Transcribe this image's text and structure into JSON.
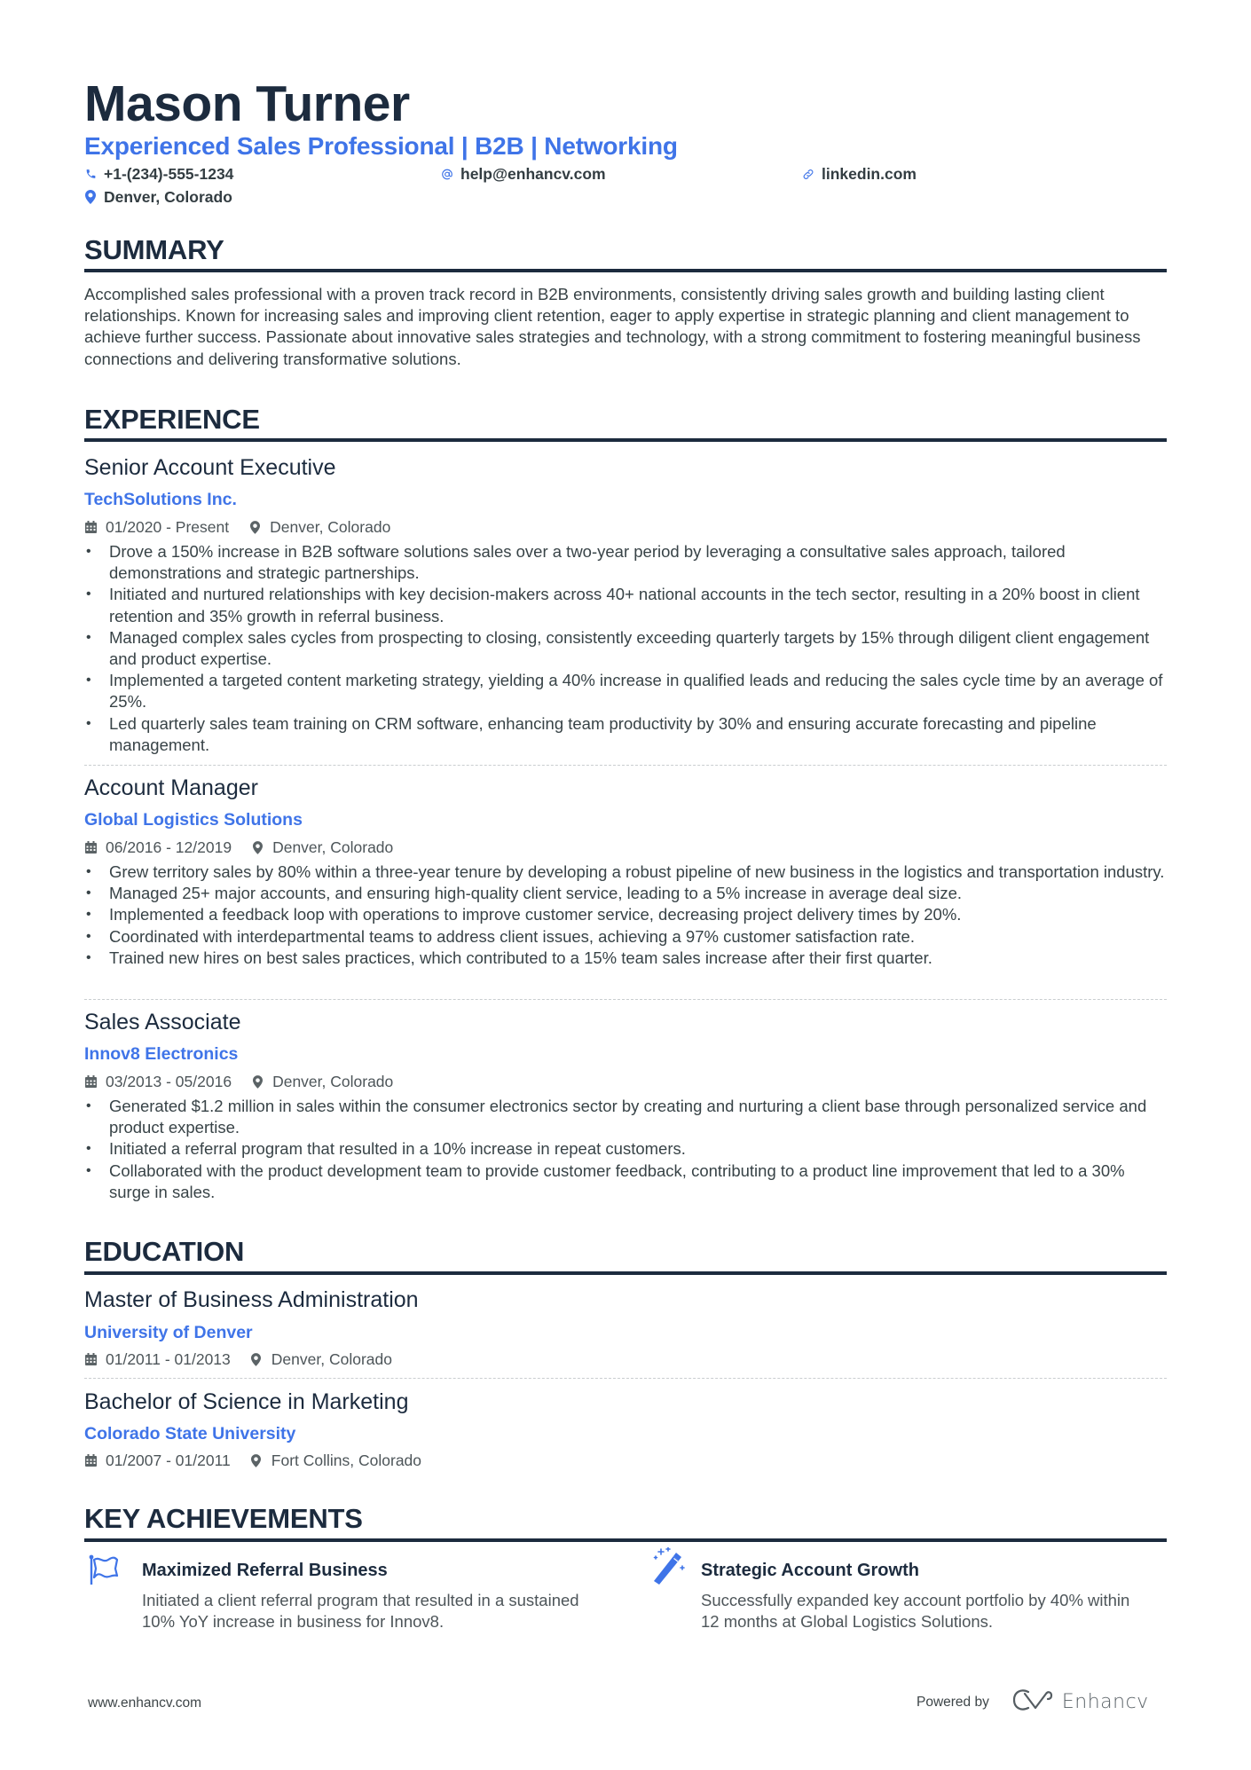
{
  "header": {
    "name": "Mason Turner",
    "tagline": "Experienced Sales Professional | B2B | Networking",
    "contacts": {
      "phone": {
        "icon": "phone-icon",
        "value": "+1-(234)-555-1234"
      },
      "email": {
        "icon": "at-icon",
        "value": "help@enhancv.com"
      },
      "link": {
        "icon": "link-icon",
        "value": "linkedin.com"
      },
      "location": {
        "icon": "map-pin-icon",
        "value": "Denver, Colorado"
      }
    }
  },
  "colors": {
    "accent": "#3f74e8",
    "heading": "#1c2b3e",
    "body": "#384347"
  },
  "summary": {
    "title": "SUMMARY",
    "text": "Accomplished sales professional with a proven track record in B2B environments, consistently driving sales growth and building lasting client relationships. Known for increasing sales and improving client retention, eager to apply expertise in strategic planning and client management to achieve further success. Passionate about innovative sales strategies and technology, with a strong commitment to fostering meaningful business connections and delivering transformative solutions."
  },
  "experience": {
    "title": "EXPERIENCE",
    "jobs": [
      {
        "title": "Senior Account Executive",
        "company": "TechSolutions Inc.",
        "dates": "01/2020 - Present",
        "location": "Denver, Colorado",
        "bullets": [
          "Drove a 150% increase in B2B software solutions sales over a two-year period by leveraging a consultative sales approach, tailored demonstrations and strategic partnerships.",
          "Initiated and nurtured relationships with key decision-makers across 40+ national accounts in the tech sector, resulting in a 20% boost in client retention and 35% growth in referral business.",
          "Managed complex sales cycles from prospecting to closing, consistently exceeding quarterly targets by 15% through diligent client engagement and product expertise.",
          "Implemented a targeted content marketing strategy, yielding a 40% increase in qualified leads and reducing the sales cycle time by an average of 25%.",
          "Led quarterly sales team training on CRM software, enhancing team productivity by 30% and ensuring accurate forecasting and pipeline management."
        ]
      },
      {
        "title": "Account Manager",
        "company": "Global Logistics Solutions",
        "dates": "06/2016 - 12/2019",
        "location": "Denver, Colorado",
        "bullets": [
          "Grew territory sales by 80% within a three-year tenure by developing a robust pipeline of new business in the logistics and transportation industry.",
          "Managed 25+ major accounts, and ensuring high-quality client service, leading to a 5% increase in average deal size.",
          "Implemented a feedback loop with operations to improve customer service, decreasing project delivery times by 20%.",
          "Coordinated with interdepartmental teams to address client issues, achieving a 97% customer satisfaction rate.",
          "Trained new hires on best sales practices, which contributed to a 15% team sales increase after their first quarter."
        ]
      },
      {
        "title": "Sales Associate",
        "company": "Innov8 Electronics",
        "dates": "03/2013 - 05/2016",
        "location": "Denver, Colorado",
        "bullets": [
          "Generated $1.2 million in sales within the consumer electronics sector by creating and nurturing a client base through personalized service and product expertise.",
          "Initiated a referral program that resulted in a 10% increase in repeat customers.",
          "Collaborated with the product development team to provide customer feedback, contributing to a product line improvement that led to a 30% surge in sales."
        ]
      }
    ]
  },
  "education": {
    "title": "EDUCATION",
    "items": [
      {
        "degree": "Master of Business Administration",
        "school": "University of Denver",
        "dates": "01/2011 - 01/2013",
        "location": "Denver, Colorado"
      },
      {
        "degree": "Bachelor of Science in Marketing",
        "school": "Colorado State University",
        "dates": "01/2007 - 01/2011",
        "location": "Fort Collins, Colorado"
      }
    ]
  },
  "achievements": {
    "title": "KEY ACHIEVEMENTS",
    "items": [
      {
        "icon": "flag-icon",
        "title": "Maximized Referral Business",
        "description": "Initiated a client referral program that resulted in a sustained 10% YoY increase in business for Innov8."
      },
      {
        "icon": "magic-wand-icon",
        "title": "Strategic Account Growth",
        "description": "Successfully expanded key account portfolio by 40% within 12 months at Global Logistics Solutions."
      }
    ]
  },
  "footer": {
    "website": "www.enhancv.com",
    "powered_by": "Powered by",
    "brand": "Enhancv"
  }
}
